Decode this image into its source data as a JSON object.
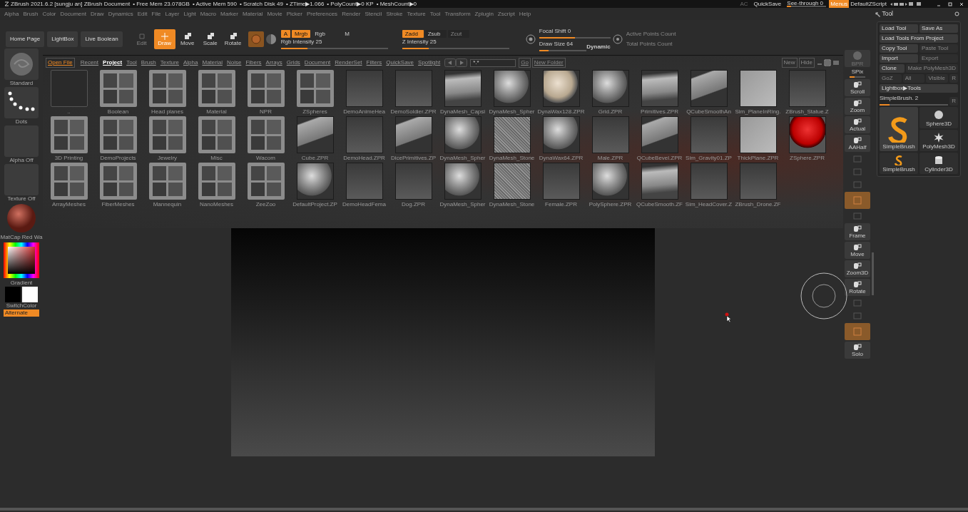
{
  "title_bar": {
    "app": "ZBrush 2021.6.2 [sungju an]",
    "document": "ZBrush Document",
    "stats": [
      "• Free Mem 23.078GB",
      "• Active Mem 590",
      "• Scratch Disk 49",
      "• ZTime▶1.066",
      "• PolyCount▶0 KP",
      "• MeshCount▶0"
    ],
    "ac": "AC",
    "quicksave": "QuickSave",
    "see_through": {
      "label": "See-through  0",
      "level": 0.1
    },
    "menus": {
      "label": "Menus",
      "selected": true
    },
    "script": "DefaultZScript"
  },
  "menu_bar": [
    "Alpha",
    "Brush",
    "Color",
    "Document",
    "Draw",
    "Dynamics",
    "Edit",
    "File",
    "Layer",
    "Light",
    "Macro",
    "Marker",
    "Material",
    "Movie",
    "Picker",
    "Preferences",
    "Render",
    "Stencil",
    "Stroke",
    "Texture",
    "Tool",
    "Transform",
    "Zplugin",
    "Zscript",
    "Help"
  ],
  "toolbar": {
    "buttons": [
      "Home Page",
      "LightBox",
      "Live Boolean"
    ],
    "modes": [
      {
        "label": "Edit",
        "selected": false,
        "disabled": true
      },
      {
        "label": "Draw",
        "selected": true,
        "disabled": false
      },
      {
        "label": "Move",
        "selected": false,
        "disabled": false
      },
      {
        "label": "Scale",
        "selected": false,
        "disabled": false
      },
      {
        "label": "Rotate",
        "selected": false,
        "disabled": false
      }
    ],
    "rgb_toggles": [
      {
        "label": "A",
        "on": true
      },
      {
        "label": "Mrgb",
        "on": true
      },
      {
        "label": "Rgb",
        "on": false
      },
      {
        "label": "M",
        "on": false
      }
    ],
    "rgb_intensity": {
      "label": "Rgb Intensity 25",
      "level": 0.25
    },
    "z_toggles": [
      {
        "label": "Zadd",
        "on": true,
        "disabled": false
      },
      {
        "label": "Zsub",
        "on": false,
        "disabled": false
      },
      {
        "label": "Zcut",
        "on": false,
        "disabled": true
      }
    ],
    "z_intensity": {
      "label": "Z Intensity 25",
      "level": 0.25
    },
    "focal_shift": {
      "label": "Focal Shift 0",
      "level": 0.5
    },
    "draw_size": {
      "label": "Draw Size 64",
      "level": 0.2
    },
    "dynamic": "Dynamic",
    "points": [
      "Active Points Count",
      "Total Points Count"
    ]
  },
  "left_shelf": {
    "items": [
      {
        "kind": "brush",
        "label": "Standard"
      },
      {
        "kind": "stroke",
        "label": "Dots"
      },
      {
        "kind": "alpha",
        "label": "Alpha Off"
      },
      {
        "kind": "texture",
        "label": "Texture Off"
      },
      {
        "kind": "material",
        "label": "MatCap Red Wa"
      }
    ],
    "gradient": "Gradient",
    "switch_color": "SwitchColor",
    "alternate": "Alternate"
  },
  "lightbox": {
    "open_file": "Open File",
    "tabs": [
      {
        "label": "Recent",
        "selected": false
      },
      {
        "label": "Project",
        "selected": true
      },
      {
        "label": "Tool",
        "selected": false
      },
      {
        "label": "Brush",
        "selected": false
      },
      {
        "label": "Texture",
        "selected": false
      },
      {
        "label": "Alpha",
        "selected": false
      },
      {
        "label": "Material",
        "selected": false
      },
      {
        "label": "Noise",
        "selected": false
      },
      {
        "label": "Fibers",
        "selected": false
      },
      {
        "label": "Arrays",
        "selected": false
      },
      {
        "label": "Grids",
        "selected": false
      },
      {
        "label": "Document",
        "selected": false
      },
      {
        "label": "RenderSet",
        "selected": false
      },
      {
        "label": "Filters",
        "selected": false
      },
      {
        "label": "QuickSave",
        "selected": false
      },
      {
        "label": "Spotlight",
        "selected": false
      }
    ],
    "filter": "*.*",
    "go": "Go",
    "new_folder": "New Folder",
    "new": "New",
    "hide": "Hide",
    "rows": [
      [
        {
          "kind": "parent",
          "label": ".."
        },
        {
          "kind": "folder",
          "label": "Boolean"
        },
        {
          "kind": "folder",
          "label": "Head planes"
        },
        {
          "kind": "folder",
          "label": "Material"
        },
        {
          "kind": "folder",
          "label": "NPR"
        },
        {
          "kind": "folder",
          "label": "ZSpheres"
        },
        {
          "kind": "model",
          "label": "DemoAnimeHea"
        },
        {
          "kind": "model",
          "label": "DemoSoldier.ZPR"
        },
        {
          "kind": "cylinder",
          "label": "DynaMesh_Capsi"
        },
        {
          "kind": "sphere",
          "label": "DynaMesh_Spher"
        },
        {
          "kind": "wax",
          "label": "DynaWax128.ZPR"
        },
        {
          "kind": "sphere",
          "label": "Grid.ZPR"
        },
        {
          "kind": "cylinder",
          "label": "Primitives.ZPR"
        },
        {
          "kind": "box",
          "label": "QCubeSmoothAn"
        },
        {
          "kind": "plane",
          "label": "Sim_PlaneInRing."
        },
        {
          "kind": "model",
          "label": "ZBrush_Statue.Z"
        }
      ],
      [
        {
          "kind": "folder",
          "label": "3D Printing"
        },
        {
          "kind": "folder",
          "label": "DemoProjects"
        },
        {
          "kind": "folder",
          "label": "Jewelry"
        },
        {
          "kind": "folder",
          "label": "Misc"
        },
        {
          "kind": "folder",
          "label": "Wacom"
        },
        {
          "kind": "box",
          "label": "Cube.ZPR"
        },
        {
          "kind": "model",
          "label": "DemoHead.ZPR"
        },
        {
          "kind": "box",
          "label": "DicePrimitives.ZP"
        },
        {
          "kind": "sphere",
          "label": "DynaMesh_Spher"
        },
        {
          "kind": "noise",
          "label": "DynaMesh_Stone"
        },
        {
          "kind": "sphere",
          "label": "DynaWax64.ZPR"
        },
        {
          "kind": "model",
          "label": "Male.ZPR"
        },
        {
          "kind": "box",
          "label": "QCubeBevel.ZPR"
        },
        {
          "kind": "model",
          "label": "Sim_Gravity01.ZP"
        },
        {
          "kind": "plane",
          "label": "ThickPlane.ZPR"
        },
        {
          "kind": "zsphere",
          "label": "ZSphere.ZPR"
        }
      ],
      [
        {
          "kind": "folder",
          "label": "ArrayMeshes"
        },
        {
          "kind": "folder",
          "label": "FiberMeshes"
        },
        {
          "kind": "folder",
          "label": "Mannequin"
        },
        {
          "kind": "folder",
          "label": "NanoMeshes"
        },
        {
          "kind": "folder",
          "label": "ZeeZoo"
        },
        {
          "kind": "sphere",
          "label": "DefaultProject.ZP"
        },
        {
          "kind": "model",
          "label": "DemoHeadFema"
        },
        {
          "kind": "model",
          "label": "Dog.ZPR"
        },
        {
          "kind": "sphere",
          "label": "DynaMesh_Spher"
        },
        {
          "kind": "noise",
          "label": "DynaMesh_Stone"
        },
        {
          "kind": "model",
          "label": "Female.ZPR"
        },
        {
          "kind": "sphere",
          "label": "PolySphere.ZPR"
        },
        {
          "kind": "cylinder",
          "label": "QCubeSmooth.ZF"
        },
        {
          "kind": "model",
          "label": "Sim_HeadCover.Z"
        },
        {
          "kind": "model",
          "label": "ZBrush_Drone.ZF"
        }
      ]
    ]
  },
  "right_shelf": [
    {
      "kind": "sphere",
      "label": "BPR"
    },
    {
      "kind": "slider",
      "label": "SPix",
      "level": 0.3
    },
    {
      "kind": "button",
      "label": "Scroll"
    },
    {
      "kind": "button",
      "label": "Zoom"
    },
    {
      "kind": "button",
      "label": "Actual"
    },
    {
      "kind": "button",
      "label": "AAHalf"
    },
    {
      "kind": "dim"
    },
    {
      "kind": "dim"
    },
    {
      "kind": "dim"
    },
    {
      "kind": "orange"
    },
    {
      "kind": "dim"
    },
    {
      "kind": "button",
      "label": "Frame"
    },
    {
      "kind": "button",
      "label": "Move"
    },
    {
      "kind": "button",
      "label": "Zoom3D"
    },
    {
      "kind": "button",
      "label": "Rotate"
    },
    {
      "kind": "dim"
    },
    {
      "kind": "dim"
    },
    {
      "kind": "orange"
    },
    {
      "kind": "button",
      "label": "Solo"
    }
  ],
  "tool_panel": {
    "title": "Tool",
    "rows": [
      [
        {
          "label": "Load Tool",
          "disabled": false
        },
        {
          "label": "Save As",
          "disabled": false
        }
      ],
      [
        {
          "label": "Load Tools From Project",
          "disabled": false
        }
      ],
      [
        {
          "label": "Copy Tool",
          "disabled": false
        },
        {
          "label": "Paste Tool",
          "disabled": true
        }
      ],
      [
        {
          "label": "Import",
          "disabled": false
        },
        {
          "label": "Export",
          "disabled": true
        }
      ],
      [
        {
          "label": "Clone",
          "disabled": false
        },
        {
          "label": "Make PolyMesh3D",
          "disabled": true
        }
      ],
      [
        {
          "label": "GoZ",
          "disabled": true
        },
        {
          "label": "All",
          "disabled": true
        },
        {
          "label": "Visible",
          "disabled": true
        },
        {
          "label": "R",
          "disabled": true
        }
      ],
      [
        {
          "label": "Lightbox▶Tools",
          "disabled": false
        }
      ]
    ],
    "slider": {
      "label": "SimpleBrush. 2",
      "level": 0.15,
      "r": "R"
    },
    "tool_columns": [
      [
        {
          "kind": "brush",
          "label": "SimpleBrush",
          "selected": true
        },
        {
          "kind": "brush-small",
          "label": "SimpleBrush",
          "selected": false
        }
      ],
      [
        {
          "kind": "sphere",
          "label": "Sphere3D",
          "selected": false
        },
        {
          "kind": "star",
          "label": "PolyMesh3D",
          "selected": false
        },
        {
          "kind": "cylinder",
          "label": "Cylinder3D",
          "selected": false
        }
      ]
    ]
  }
}
